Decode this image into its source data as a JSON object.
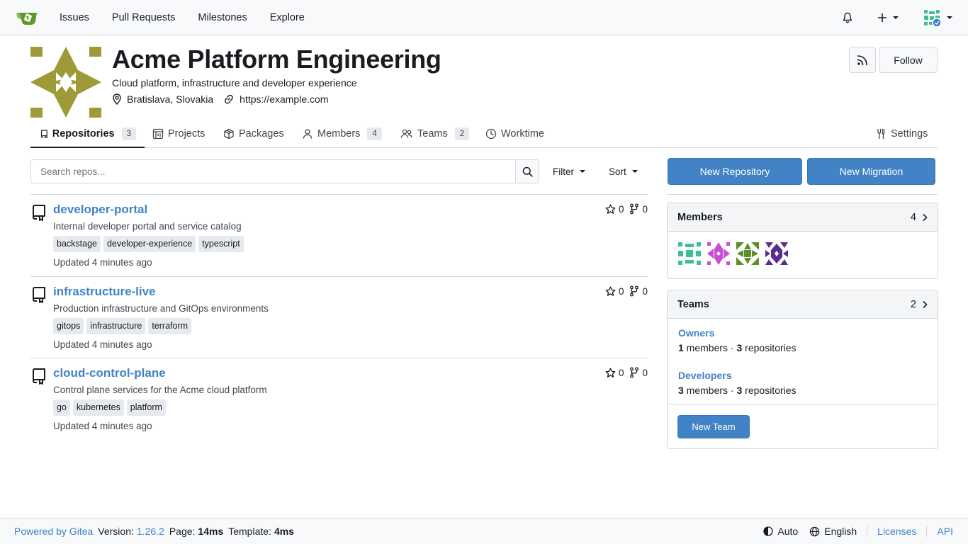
{
  "navbar": {
    "logo": "gitea-logo-icon",
    "links": [
      "Issues",
      "Pull Requests",
      "Milestones",
      "Explore"
    ]
  },
  "org": {
    "name": "Acme Platform Engineering",
    "description": "Cloud platform, infrastructure and developer experience",
    "location": "Bratislava, Slovakia",
    "website": "https://example.com",
    "follow_label": "Follow"
  },
  "tabs": [
    {
      "label": "Repositories",
      "count": "3",
      "icon": "repo-icon",
      "active": true
    },
    {
      "label": "Projects",
      "icon": "project-icon"
    },
    {
      "label": "Packages",
      "icon": "package-icon"
    },
    {
      "label": "Members",
      "count": "4",
      "icon": "person-icon"
    },
    {
      "label": "Teams",
      "count": "2",
      "icon": "people-icon"
    },
    {
      "label": "Worktime",
      "icon": "clock-icon"
    }
  ],
  "settings_label": "Settings",
  "search": {
    "placeholder": "Search repos...",
    "filter_label": "Filter",
    "sort_label": "Sort"
  },
  "repos": [
    {
      "name": "developer-portal",
      "description": "Internal developer portal and service catalog",
      "topics": [
        "backstage",
        "developer-experience",
        "typescript"
      ],
      "stars": "0",
      "forks": "0",
      "updated": "Updated 4 minutes ago"
    },
    {
      "name": "infrastructure-live",
      "description": "Production infrastructure and GitOps environments",
      "topics": [
        "gitops",
        "infrastructure",
        "terraform"
      ],
      "stars": "0",
      "forks": "0",
      "updated": "Updated 4 minutes ago"
    },
    {
      "name": "cloud-control-plane",
      "description": "Control plane services for the Acme cloud platform",
      "topics": [
        "go",
        "kubernetes",
        "platform"
      ],
      "stars": "0",
      "forks": "0",
      "updated": "Updated 4 minutes ago"
    }
  ],
  "actions": {
    "new_repo": "New Repository",
    "new_migration": "New Migration"
  },
  "members_panel": {
    "title": "Members",
    "count": "4",
    "avatar_colors": [
      "#3dbf8f",
      "#c84fd0",
      "#5c8f2a",
      "#5b2d91"
    ]
  },
  "teams_panel": {
    "title": "Teams",
    "count": "2",
    "teams": [
      {
        "name": "Owners",
        "members": "1",
        "members_label": " members · ",
        "repos": "3",
        "repos_label": " repositories"
      },
      {
        "name": "Developers",
        "members": "3",
        "members_label": " members · ",
        "repos": "3",
        "repos_label": " repositories"
      }
    ],
    "new_team_label": "New Team"
  },
  "footer": {
    "powered_by": "Powered by Gitea",
    "version_label": "Version:",
    "version": "1.26.2",
    "page_label": "Page:",
    "page_time": "14ms",
    "template_label": "Template:",
    "template_time": "4ms",
    "theme": "Auto",
    "language": "English",
    "licenses": "Licenses",
    "api": "API"
  },
  "colors": {
    "accent": "#4183c4",
    "org_avatar": "#9d9a37",
    "logo_green": "#609926"
  }
}
